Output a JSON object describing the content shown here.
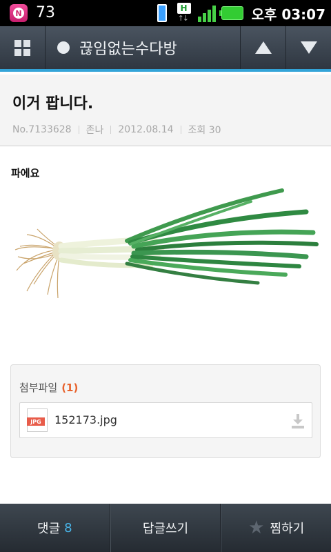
{
  "status_bar": {
    "notification_app_icon": "chat-n-icon",
    "notification_badge_letter": "N",
    "notification_count": "73",
    "data_indicator": "H",
    "time": "오후 03:07",
    "signal_level": 4,
    "colors": {
      "battery": "#33cc33",
      "signal": "#47d147",
      "app_icon": "#d0246f"
    }
  },
  "title_bar": {
    "menu_icon": "grid-icon",
    "cafe_name": "끊임없는수다방",
    "prev_icon": "triangle-up-icon",
    "next_icon": "triangle-down-icon",
    "accent_color": "#33a4d8"
  },
  "post": {
    "title": "이거 팝니다.",
    "number": "No.7133628",
    "author": "존나",
    "date": "2012.08.14",
    "views": "조회 30",
    "body_text": "파에요",
    "image_subject": "green-onion-image"
  },
  "attachments": {
    "label": "첨부파일",
    "count": "(1)",
    "files": [
      {
        "name": "152173.jpg",
        "type_badge": "JPG",
        "icon": "jpg-file-icon"
      }
    ],
    "count_color": "#e8622c"
  },
  "bottom_bar": {
    "comments_label": "댓글",
    "comments_count": "8",
    "reply_label": "답글쓰기",
    "bookmark_label": "찜하기",
    "bookmark_icon": "star-icon",
    "count_color": "#49b6ea"
  }
}
